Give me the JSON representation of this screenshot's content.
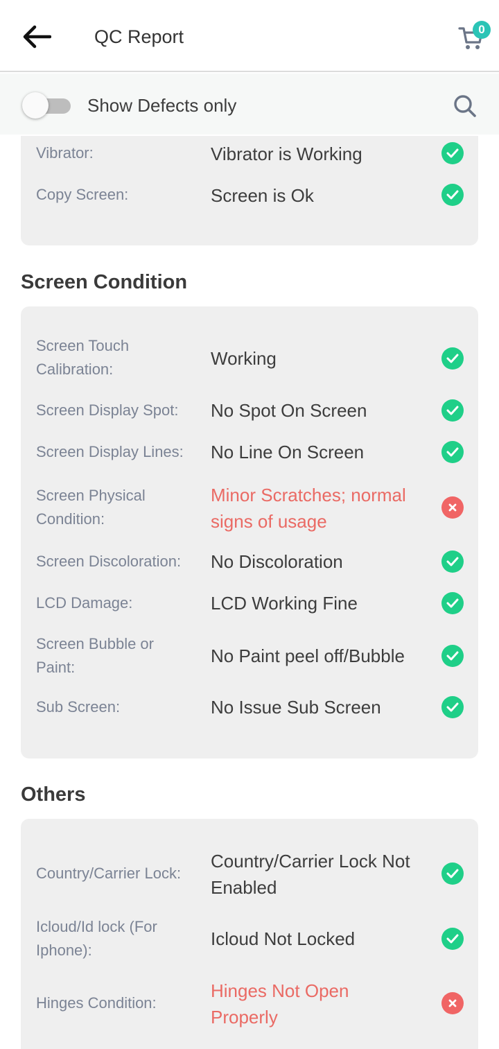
{
  "header": {
    "title": "QC Report",
    "cart_count": "0"
  },
  "filter": {
    "label": "Show Defects only"
  },
  "top_card": {
    "rows": [
      {
        "label": "Vibrator:",
        "value": "Vibrator is Working",
        "status": "ok"
      },
      {
        "label": "Copy Screen:",
        "value": "Screen is Ok",
        "status": "ok"
      }
    ]
  },
  "screen_condition": {
    "title": "Screen Condition",
    "rows": [
      {
        "label": "Screen Touch Calibration:",
        "value": "Working",
        "status": "ok"
      },
      {
        "label": "Screen Display Spot:",
        "value": "No Spot On Screen",
        "status": "ok"
      },
      {
        "label": "Screen Display Lines:",
        "value": "No Line On Screen",
        "status": "ok"
      },
      {
        "label": "Screen Physical Condition:",
        "value": "Minor Scratches; normal signs of usage",
        "status": "bad"
      },
      {
        "label": "Screen Discoloration:",
        "value": "No Discoloration",
        "status": "ok"
      },
      {
        "label": "LCD Damage:",
        "value": "LCD Working Fine",
        "status": "ok"
      },
      {
        "label": "Screen Bubble or Paint:",
        "value": "No Paint peel off/Bubble",
        "status": "ok"
      },
      {
        "label": "Sub Screen:",
        "value": "No Issue Sub Screen",
        "status": "ok"
      }
    ]
  },
  "others": {
    "title": "Others",
    "rows": [
      {
        "label": "Country/Carrier Lock:",
        "value": "Country/Carrier Lock Not Enabled",
        "status": "ok"
      },
      {
        "label": "Icloud/Id lock (For Iphone):",
        "value": "Icloud Not Locked",
        "status": "ok"
      },
      {
        "label": "Hinges Condition:",
        "value": "Hinges Not Open Properly",
        "status": "bad"
      }
    ]
  },
  "colors": {
    "ok": "#1fcf88",
    "bad": "#f06565",
    "badge": "#2bc4b6",
    "defect_text": "#ea6a64"
  }
}
